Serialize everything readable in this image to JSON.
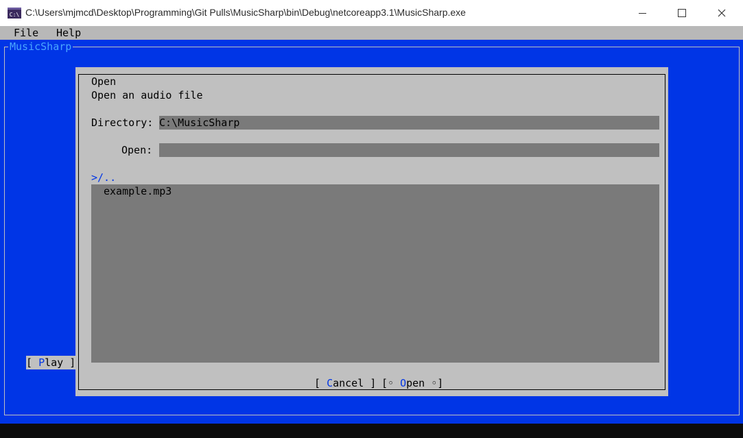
{
  "window": {
    "title": "C:\\Users\\mjmcd\\Desktop\\Programming\\Git Pulls\\MusicSharp\\bin\\Debug\\netcoreapp3.1\\MusicSharp.exe",
    "icon_text": "C:\\"
  },
  "menu": {
    "items": [
      {
        "label": "File"
      },
      {
        "label": "Help"
      }
    ]
  },
  "main_window": {
    "title": "MusicSharp",
    "play_button": {
      "left": "[ ",
      "hotkey": "P",
      "rest": "lay ]"
    }
  },
  "dialog": {
    "title": "Open",
    "prompt": "Open an audio file",
    "directory_label": "Directory:",
    "directory_value": "C:\\MusicSharp",
    "open_label": "Open:",
    "open_value": "",
    "current_path": ">/..",
    "files": [
      "example.mp3"
    ],
    "cancel_button": {
      "left": "[ ",
      "hotkey": "C",
      "rest": "ancel ]"
    },
    "open_button": {
      "left": "[◦ ",
      "hotkey": "O",
      "rest": "pen ◦]"
    }
  },
  "colors": {
    "console_blue": "#0035e6",
    "dialog_gray": "#c0c0c0",
    "field_gray": "#7a7a7a",
    "title_accent": "#4aa6ff"
  }
}
